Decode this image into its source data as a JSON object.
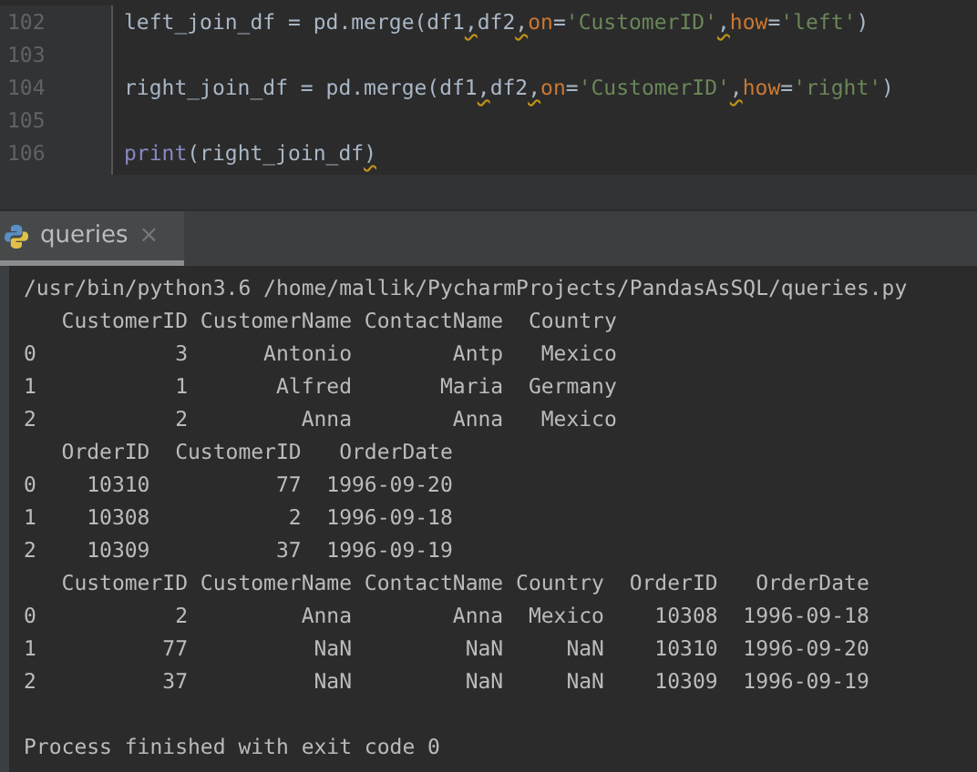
{
  "editor": {
    "lines": [
      {
        "number": "102",
        "tokens": [
          {
            "text": "left_join_df = pd.merge(df1",
            "kind": "plain"
          },
          {
            "text": ",",
            "kind": "warn"
          },
          {
            "text": "df2",
            "kind": "plain"
          },
          {
            "text": ",",
            "kind": "warn"
          },
          {
            "text": "on",
            "kind": "param"
          },
          {
            "text": "=",
            "kind": "plain"
          },
          {
            "text": "'CustomerID'",
            "kind": "string"
          },
          {
            "text": ",",
            "kind": "warn"
          },
          {
            "text": "how",
            "kind": "param"
          },
          {
            "text": "=",
            "kind": "plain"
          },
          {
            "text": "'left'",
            "kind": "string"
          },
          {
            "text": ")",
            "kind": "plain"
          }
        ]
      },
      {
        "number": "103"
      },
      {
        "number": "104",
        "tokens": [
          {
            "text": "right_join_df = pd.merge(df1",
            "kind": "plain"
          },
          {
            "text": ",",
            "kind": "warn"
          },
          {
            "text": "df2",
            "kind": "plain"
          },
          {
            "text": ",",
            "kind": "warn"
          },
          {
            "text": "on",
            "kind": "param"
          },
          {
            "text": "=",
            "kind": "plain"
          },
          {
            "text": "'CustomerID'",
            "kind": "string"
          },
          {
            "text": ",",
            "kind": "warn"
          },
          {
            "text": "how",
            "kind": "param"
          },
          {
            "text": "=",
            "kind": "plain"
          },
          {
            "text": "'right'",
            "kind": "string"
          },
          {
            "text": ")",
            "kind": "plain"
          }
        ]
      },
      {
        "number": "105"
      },
      {
        "number": "106",
        "tokens": [
          {
            "text": "print",
            "kind": "builtin"
          },
          {
            "text": "(right_join_df",
            "kind": "plain"
          },
          {
            "text": ")",
            "kind": "warn"
          }
        ]
      }
    ]
  },
  "run_tab": {
    "label": "queries",
    "close": "×",
    "selected": true
  },
  "console": {
    "lines": [
      "/usr/bin/python3.6 /home/mallik/PycharmProjects/PandasAsSQL/queries.py",
      "   CustomerID CustomerName ContactName  Country",
      "0           3      Antonio        Antp   Mexico",
      "1           1       Alfred       Maria  Germany",
      "2           2         Anna        Anna   Mexico",
      "   OrderID  CustomerID   OrderDate",
      "0    10310          77  1996-09-20",
      "1    10308           2  1996-09-18",
      "2    10309          37  1996-09-19",
      "   CustomerID CustomerName ContactName Country  OrderID   OrderDate",
      "0           2         Anna        Anna  Mexico    10308  1996-09-18",
      "1          77          NaN         NaN     NaN    10310  1996-09-20",
      "2          37          NaN         NaN     NaN    10309  1996-09-19"
    ],
    "exit_message": "Process finished with exit code 0"
  }
}
